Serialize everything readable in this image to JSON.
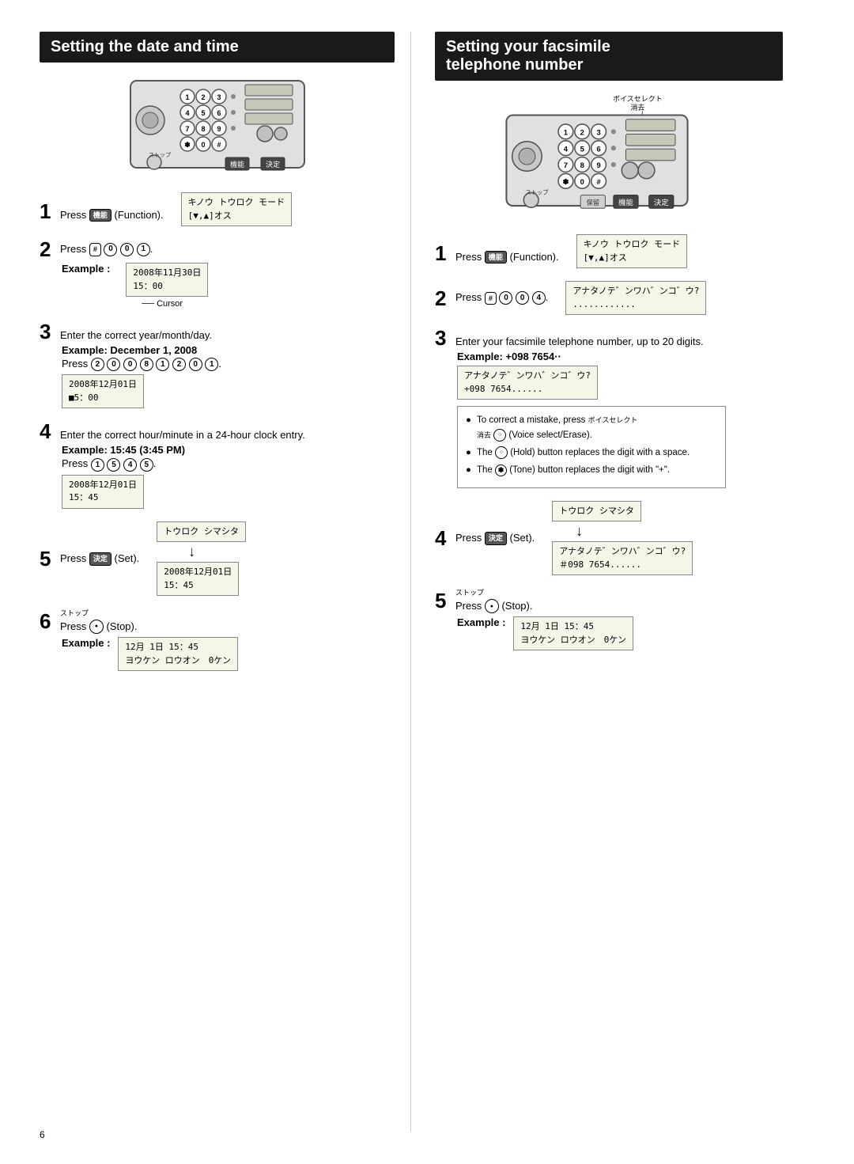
{
  "left": {
    "title": "Setting the date and time",
    "steps": {
      "step1": {
        "number": "1",
        "text": "Press",
        "button": "機能",
        "suffix": "(Function).",
        "screen_label": "キノウ トウロク モード",
        "screen_line2": "[▼,▲]オス"
      },
      "step2": {
        "number": "2",
        "text": "Press",
        "buttons": [
          "#",
          "0",
          "0",
          "1"
        ],
        "screen_label": "2008年11月30日",
        "screen_line2": "15：00",
        "cursor_text": "Cursor",
        "example_label": "Example :"
      },
      "step3": {
        "number": "3",
        "text": "Enter the correct year/month/day.",
        "bold_text": "Example: December 1, 2008",
        "press_text": "Press",
        "buttons": [
          "2",
          "0",
          "0",
          "8",
          "1",
          "2",
          "0",
          "1"
        ],
        "screen_label": "2008年12月01日",
        "screen_line2": "■5：00"
      },
      "step4": {
        "number": "4",
        "text": "Enter the correct hour/minute in a 24-hour clock entry.",
        "bold_text": "Example: 15:45 (3:45 PM)",
        "press_text": "Press",
        "buttons": [
          "1",
          "5",
          "4",
          "5"
        ],
        "screen_label": "2008年12月01日",
        "screen_line2": "15：45"
      },
      "step5": {
        "number": "5",
        "text": "Press",
        "button": "決定",
        "suffix": "(Set).",
        "screen_top": "トウロク シマシタ",
        "arrow": "↓",
        "screen_bottom_line1": "2008年12月01日",
        "screen_bottom_line2": "15：45"
      },
      "step6": {
        "number": "6",
        "text": "Press",
        "stop_label": "ストップ",
        "suffix": "(Stop).",
        "example_label": "Example :",
        "screen_line1": "12月 1日 15：45",
        "screen_line2": "ヨウケン ロウオン　0ケン"
      }
    }
  },
  "right": {
    "title_line1": "Setting your facsimile",
    "title_line2": "telephone number",
    "steps": {
      "step1": {
        "number": "1",
        "text": "Press",
        "button": "機能",
        "suffix": "(Function).",
        "screen_label": "キノウ トウロク モード",
        "screen_line2": "[▼,▲]オス"
      },
      "step2": {
        "number": "2",
        "text": "Press",
        "buttons": [
          "#",
          "0",
          "0",
          "4"
        ],
        "screen_label": "アナタノテ゛ンワハ゛ンコ゛ウ?",
        "screen_line2": "............"
      },
      "step3": {
        "number": "3",
        "text": "Enter your facsimile telephone number, up to 20 digits.",
        "bold_text": "Example: +098 7654··",
        "screen_label": "アナタノテ゛ンワハ゛ンコ゛ウ?",
        "screen_line2": "+098 7654......",
        "notes": [
          "To correct a mistake, press ボイスセレクト 消去 (Voice select/Erase).",
          "The 保留 (Hold) button replaces the digit with a space.",
          "The ✽ (Tone) button replaces the digit with \"+\"."
        ],
        "note_labels": [
          "ボイスセレクト 消去",
          "保留",
          "✽"
        ]
      },
      "step4": {
        "number": "4",
        "text": "Press",
        "button": "決定",
        "suffix": "(Set).",
        "screen_top": "トウロク シマシタ",
        "arrow": "↓",
        "screen_bottom_line1": "アナタノテ゛ンワハ゛ンコ゛ウ?",
        "screen_bottom_line2": "＃098 7654......"
      },
      "step5": {
        "number": "5",
        "text": "Press",
        "stop_label": "ストップ",
        "suffix": "(Stop).",
        "example_label": "Example :",
        "screen_line1": "12月 1日 15：45",
        "screen_line2": "ヨウケン ロウオン　0ケン"
      }
    },
    "label_voice": "ボイスセレクト\n消去",
    "label_hold": "保留"
  },
  "page_number": "6"
}
